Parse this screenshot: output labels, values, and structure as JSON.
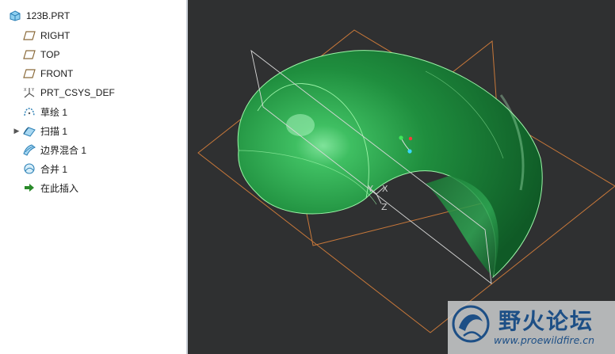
{
  "model_tree": {
    "items": [
      {
        "label": "123B.PRT",
        "icon": "part-cube-icon",
        "expandable": false
      },
      {
        "label": "RIGHT",
        "icon": "datum-plane-icon",
        "expandable": false
      },
      {
        "label": "TOP",
        "icon": "datum-plane-icon",
        "expandable": false
      },
      {
        "label": "FRONT",
        "icon": "datum-plane-icon",
        "expandable": false
      },
      {
        "label": "PRT_CSYS_DEF",
        "icon": "coordinate-system-icon",
        "expandable": false
      },
      {
        "label": "草绘 1",
        "icon": "sketch-icon",
        "expandable": false
      },
      {
        "label": "扫描 1",
        "icon": "sweep-icon",
        "expandable": true
      },
      {
        "label": "边界混合 1",
        "icon": "boundary-blend-icon",
        "expandable": false
      },
      {
        "label": "合并 1",
        "icon": "merge-icon",
        "expandable": false
      },
      {
        "label": "在此插入",
        "icon": "insert-here-arrow-icon",
        "expandable": false
      }
    ]
  },
  "viewport": {
    "background": "#2f3031",
    "surface_color": "#1e8a3a",
    "datum_plane_color": "#c8783a",
    "edge_color": "#9cf5a8",
    "axis_labels": {
      "y": "Y",
      "x": "X",
      "z": "Z"
    }
  },
  "watermark": {
    "title": "野火论坛",
    "url": "www.proewildfire.cn",
    "color": "#1d4f86"
  }
}
